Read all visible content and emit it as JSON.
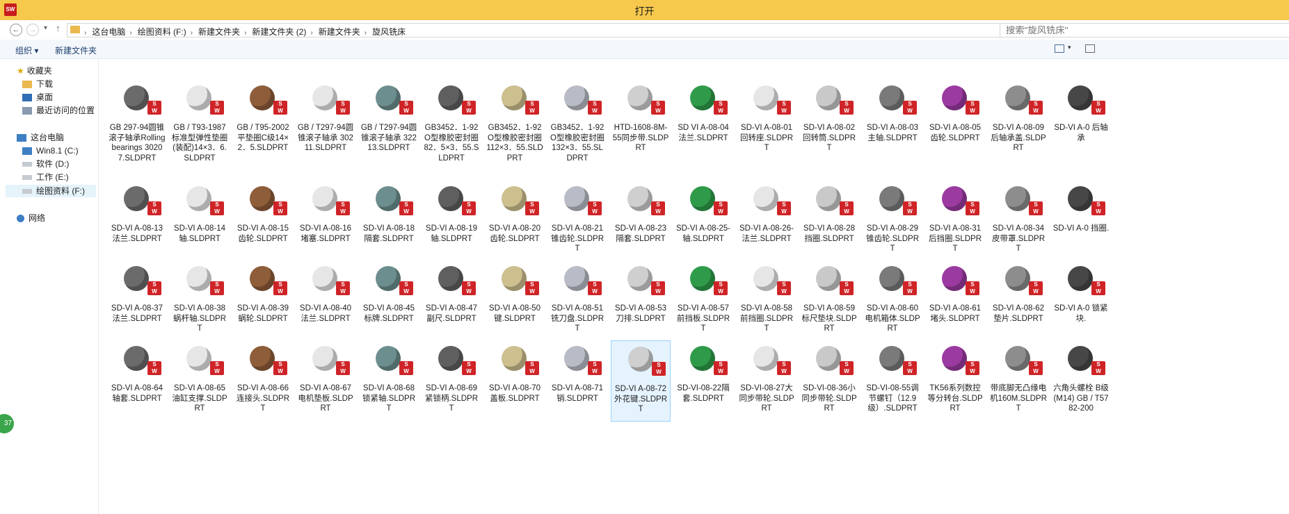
{
  "window": {
    "title": "打开",
    "app_badge": "SW 2016"
  },
  "address": {
    "crumbs": [
      "这台电脑",
      "绘图资料 (F:)",
      "新建文件夹",
      "新建文件夹 (2)",
      "新建文件夹",
      "旋风铣床"
    ],
    "search_placeholder": "搜索\"旋风铣床\""
  },
  "toolbar": {
    "organize": "组织 ▾",
    "new_folder": "新建文件夹"
  },
  "nav": {
    "favorites": "收藏夹",
    "favorite_items": [
      "下载",
      "桌面",
      "最近访问的位置"
    ],
    "this_pc": "这台电脑",
    "drives": [
      "Win8.1 (C:)",
      "软件 (D:)",
      "工作 (E:)",
      "绘图资料 (F:)"
    ],
    "network": "网络"
  },
  "badge_text": "37",
  "colors": {
    "titlebar": "#f6c84b",
    "sw_badge": "#cf2427",
    "selection": "#e5f3ff"
  },
  "files": [
    "GB 297-94圆锥滚子轴承Rolling bearings 30207.SLDPRT",
    "GB / T93-1987 标准型弹性垫圈(装配)14×3．6.SLDPRT",
    "GB / T95-2002 平垫圈C级14×2．5.SLDPRT",
    "GB / T297-94圆锥滚子轴承 30211.SLDPRT",
    "GB / T297-94圆锥滚子轴承 32213.SLDPRT",
    "GB3452．1-92O型橡胶密封圈82．5×3．55.SLDPRT",
    "GB3452．1-92O型橡胶密封圈112×3．55.SLDPRT",
    "GB3452．1-92O型橡胶密封圈132×3．55.SLDPRT",
    "HTD-1608-8M-55同步带.SLDPRT",
    "SD VI A-08-04 法兰.SLDPRT",
    "SD-VI A-08-01 回转座.SLDPRT",
    "SD-VI A-08-02 回转筒.SLDPRT",
    "SD-VI A-08-03 主轴.SLDPRT",
    "SD-VI A-08-05 齿轮.SLDPRT",
    "SD-VI A-08-09 后轴承盖.SLDPRT",
    "SD-VI A-0 后轴承",
    "SD-VI A-08-13 法兰.SLDPRT",
    "SD-VI A-08-14 轴.SLDPRT",
    "SD-VI A-08-15 齿轮.SLDPRT",
    "SD-VI A-08-16 堵塞.SLDPRT",
    "SD-VI A-08-18 隔套.SLDPRT",
    "SD-VI A-08-19 轴.SLDPRT",
    "SD-VI A-08-20 齿轮.SLDPRT",
    "SD-VI A-08-21 锥齿轮.SLDPRT",
    "SD-VI A-08-23 隔套.SLDPRT",
    "SD-VI A-08-25-轴.SLDPRT",
    "SD-VI A-08-26-法兰.SLDPRT",
    "SD-VI A-08-28 挡圈.SLDPRT",
    "SD-VI A-08-29 锥齿轮.SLDPRT",
    "SD-VI A-08-31 后挡圈.SLDPRT",
    "SD-VI A-08-34 皮带罩.SLDPRT",
    "SD-VI A-0 挡圈.",
    "SD-VI A-08-37 法兰.SLDPRT",
    "SD-VI A-08-38 蜗杆轴.SLDPRT",
    "SD-VI A-08-39 蜗轮.SLDPRT",
    "SD-VI A-08-40 法兰.SLDPRT",
    "SD-VI A-08-45 标牌.SLDPRT",
    "SD-VI A-08-47 副尺.SLDPRT",
    "SD-VI A-08-50 键.SLDPRT",
    "SD-VI A-08-51 铣刀盘.SLDPRT",
    "SD-VI A-08-53 刀排.SLDPRT",
    "SD-VI A-08-57 前挡板.SLDPRT",
    "SD-VI A-08-58 前挡圈.SLDPRT",
    "SD-VI A-08-59 标尺垫块.SLDPRT",
    "SD-VI A-08-60 电机箱体.SLDPRT",
    "SD-VI A-08-61 堵头.SLDPRT",
    "SD-VI A-08-62 垫片.SLDPRT",
    "SD-VI A-0 锁紧块.",
    "SD-VI A-08-64 轴套.SLDPRT",
    "SD-VI A-08-65 油缸支撑.SLDPRT",
    "SD-VI A-08-66 连接头.SLDPRT",
    "SD-VI A-08-67 电机垫板.SLDPRT",
    "SD-VI A-08-68 锁紧轴.SLDPRT",
    "SD-VI A-08-69 紧锁柄.SLDPRT",
    "SD-VI A-08-70 盖板.SLDPRT",
    "SD-VI A-08-71 销.SLDPRT",
    "SD-VI A-08-72 外花键.SLDPRT",
    "SD-VI-08-22隔套.SLDPRT",
    "SD-VI-08-27大同步带轮.SLDPRT",
    "SD-VI-08-36小同步带轮.SLDPRT",
    "SD-VI-08-55调节螺钉（12.9级）.SLDPRT",
    "TK56系列数控等分转台.SLDPRT",
    "带底脚无凸缘电机160M.SLDPRT",
    "六角头螺栓 B级(M14) GB / T5782-200"
  ]
}
